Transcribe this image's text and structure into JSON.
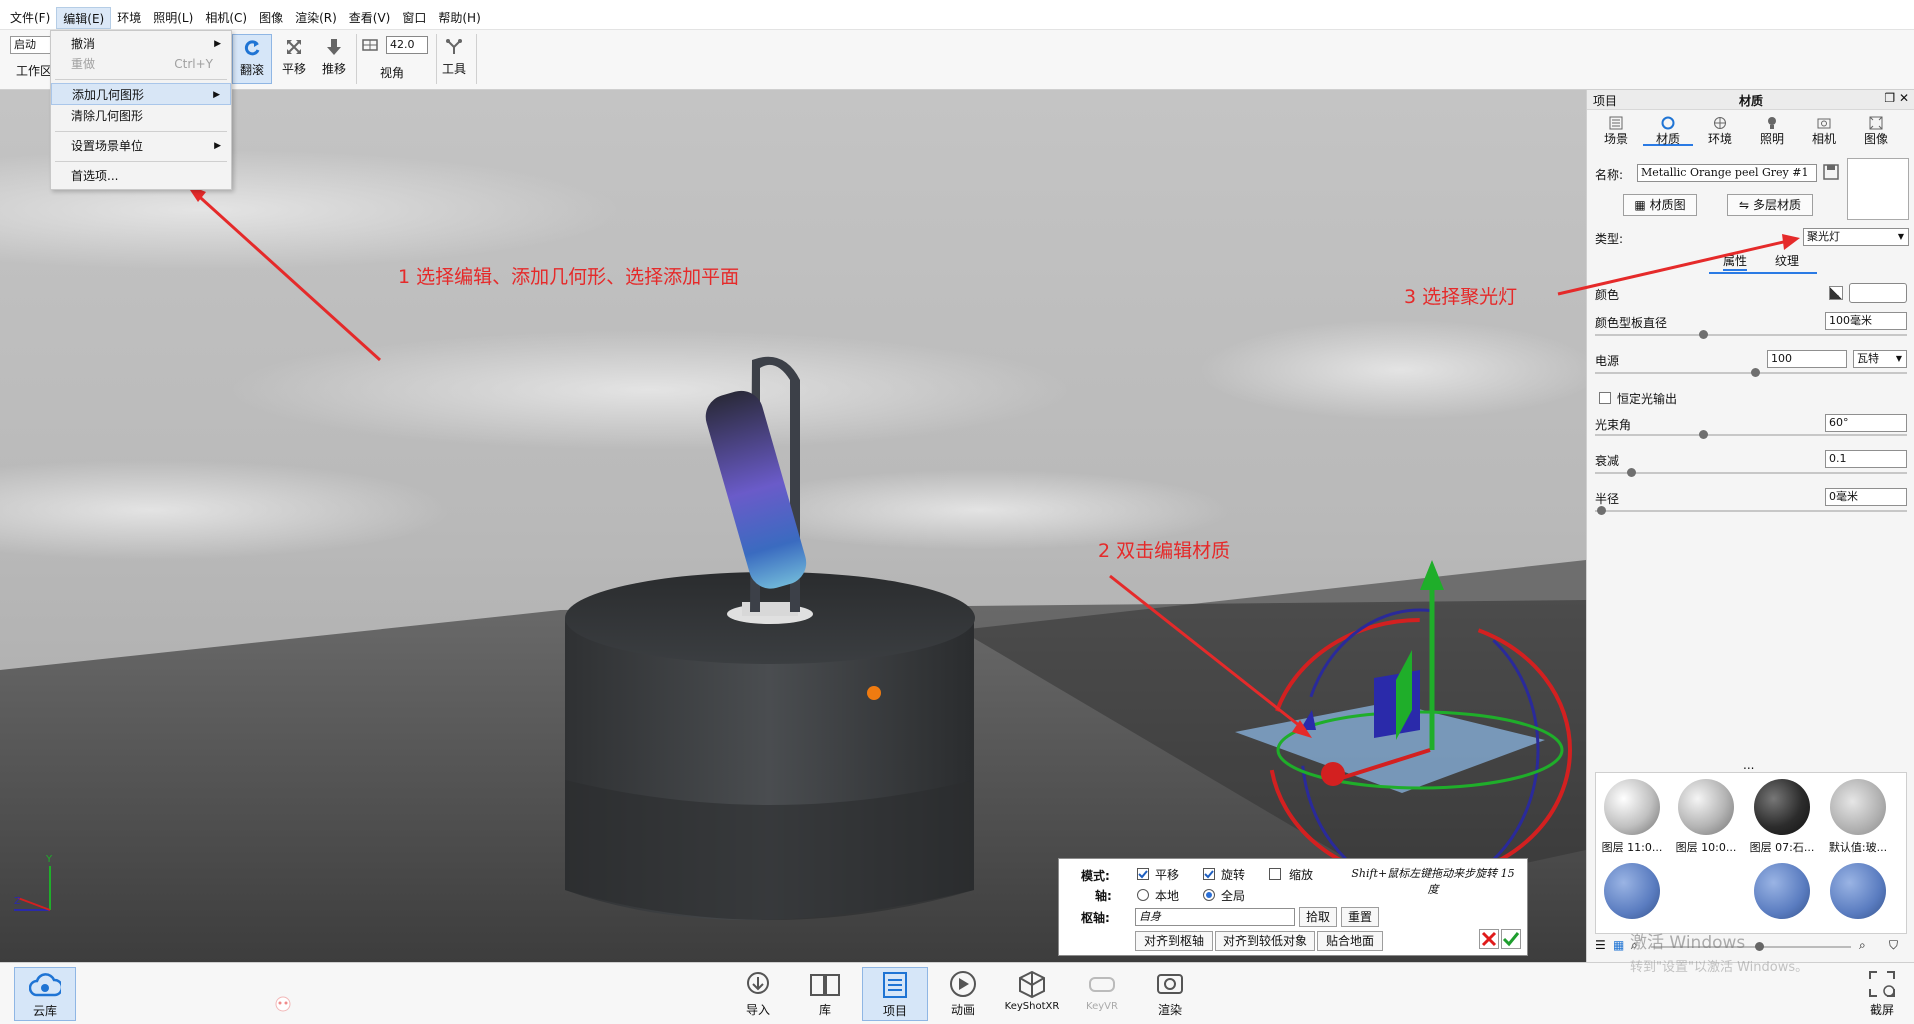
{
  "menubar": {
    "items": [
      "文件(F)",
      "编辑(E)",
      "环境",
      "照明(L)",
      "相机(C)",
      "图像",
      "渲染(R)",
      "查看(V)",
      "窗口",
      "帮助(H)"
    ]
  },
  "toolbar": {
    "combo_value": "启动",
    "workspace_label": "工作区",
    "tumble_label": "翻滚",
    "pan_label": "平移",
    "dolly_label": "推移",
    "fov_value": "42.0",
    "fov_label": "视角",
    "tools_label": "工具"
  },
  "edit_menu": {
    "undo": "撤消",
    "redo": "重做",
    "redo_shortcut": "Ctrl+Y",
    "add_geometry": "添加几何图形",
    "clear_geometry": "清除几何图形",
    "scene_units": "设置场景单位",
    "preferences": "首选项..."
  },
  "annotations": {
    "step1": "1 选择编辑、添加几何形、选择添加平面",
    "step2": "2 双击编辑材质",
    "step3": "3 选择聚光灯"
  },
  "panel": {
    "header_left": "项目",
    "header_title": "材质",
    "tabs": [
      "场景",
      "材质",
      "环境",
      "照明",
      "相机",
      "图像"
    ],
    "name_label": "名称:",
    "name_value": "Metallic Orange peel Grey #1",
    "material_graph_btn": "材质图",
    "multilayer_btn": "多层材质",
    "type_label": "类型:",
    "type_value": "聚光灯",
    "subtab_props": "属性",
    "subtab_texture": "纹理",
    "color_label": "颜色",
    "swatch_diameter_label": "颜色型板直径",
    "swatch_diameter_value": "100毫米",
    "power_label": "电源",
    "power_value": "100",
    "power_unit": "瓦特",
    "constant_output_label": "恒定光输出",
    "beam_angle_label": "光束角",
    "beam_angle_value": "60°",
    "falloff_label": "衰减",
    "falloff_value": "0.1",
    "radius_label": "半径",
    "radius_value": "0毫米",
    "library": [
      {
        "label": "图层 11:0..."
      },
      {
        "label": "图层 10:0..."
      },
      {
        "label": "图层 07:石..."
      },
      {
        "label": "默认值:玻..."
      }
    ],
    "more_dots": "..."
  },
  "transform": {
    "mode_label": "模式:",
    "axis_label": "轴:",
    "pivot_label": "枢轴:",
    "translate": "平移",
    "rotate": "旋转",
    "scale": "缩放",
    "local": "本地",
    "global": "全局",
    "pivot_value": "自身",
    "pick_btn": "拾取",
    "reset_btn": "重置",
    "align_pivot_btn": "对齐到枢轴",
    "align_lower_btn": "对齐到较低对象",
    "snap_ground_btn": "贴合地面",
    "hint": "Shift+鼠标左键拖动来步旋转 15 度"
  },
  "bottombar": {
    "cloud": "云库",
    "import": "导入",
    "library": "库",
    "project": "项目",
    "animation": "动画",
    "keyshotxr": "KeyShotXR",
    "keyvr": "KeyVR",
    "render": "渲染",
    "screenshot": "截屏",
    "watermark_title": "激活 Windows",
    "watermark_sub": "转到\"设置\"以激活 Windows。"
  },
  "colors": {
    "annotation": "#e52a2a",
    "accent": "#2a7ae4"
  }
}
